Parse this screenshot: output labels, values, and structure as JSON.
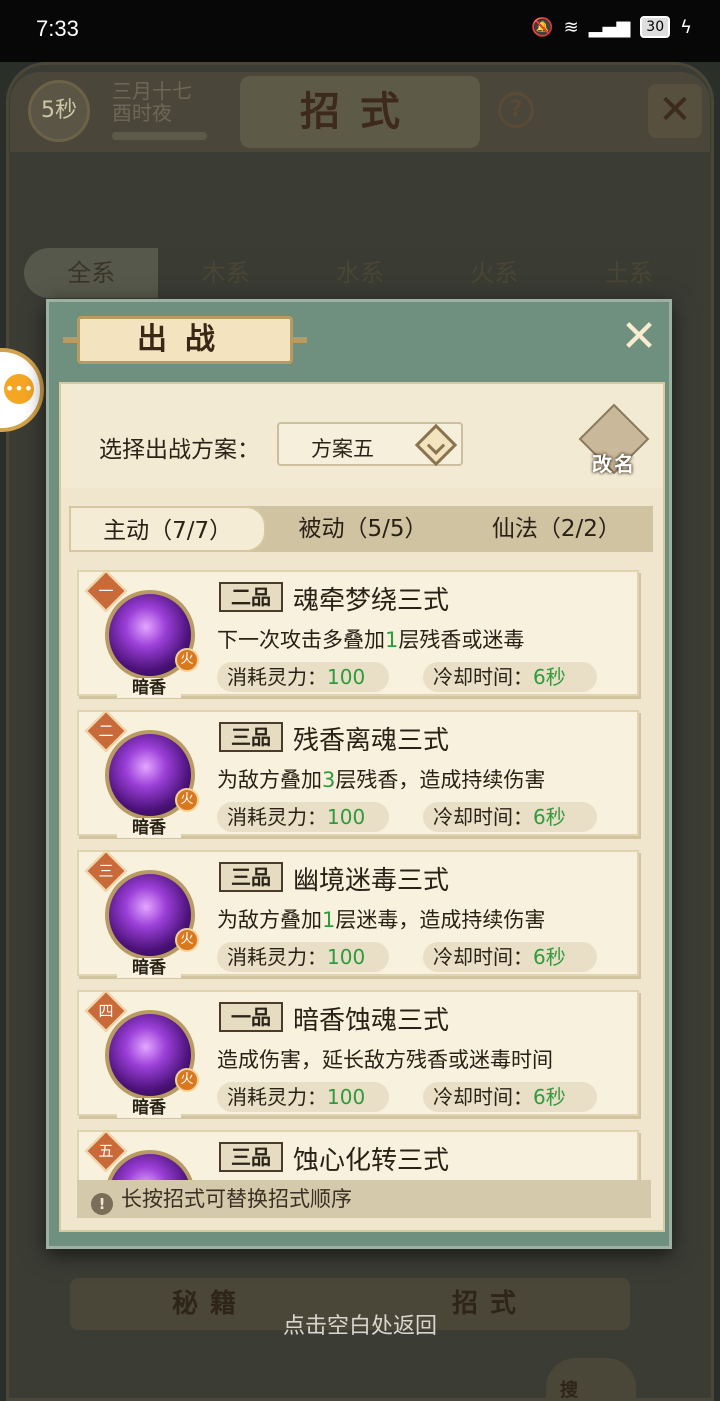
{
  "status_bar": {
    "time": "7:33",
    "battery": "30"
  },
  "background": {
    "timer": "5秒",
    "date_line1": "三月十七",
    "date_line2": "酉时夜",
    "title": "招式",
    "help": "?",
    "close": "✕",
    "element_tabs": [
      "全系",
      "木系",
      "水系",
      "火系",
      "土系"
    ],
    "bottom_tabs": [
      "秘籍",
      "招式"
    ],
    "return_hint": "点击空白处返回",
    "search": "搜"
  },
  "dialog": {
    "title": "出战",
    "close": "✕",
    "plan_label": "选择出战方案：",
    "plan_value": "方案五",
    "rename_label": "改名",
    "type_tabs": [
      "主动（7/7）",
      "被动（5/5）",
      "仙法（2/2）"
    ],
    "skills": [
      {
        "ordinal": "一",
        "grade": "二品",
        "name": "魂牵梦绕三式",
        "desc_pre": "下一次攻击多叠加",
        "desc_num": "1",
        "desc_post": "层残香或迷毒",
        "cost_label": "消耗灵力：",
        "cost": "100",
        "cd_label": "冷却时间：",
        "cd": "6秒",
        "icon_tag": "暗香",
        "element": "火"
      },
      {
        "ordinal": "二",
        "grade": "三品",
        "name": "残香离魂三式",
        "desc_pre": "为敌方叠加",
        "desc_num": "3",
        "desc_post": "层残香，造成持续伤害",
        "cost_label": "消耗灵力：",
        "cost": "100",
        "cd_label": "冷却时间：",
        "cd": "6秒",
        "icon_tag": "暗香",
        "element": "火"
      },
      {
        "ordinal": "三",
        "grade": "三品",
        "name": "幽境迷毒三式",
        "desc_pre": "为敌方叠加",
        "desc_num": "1",
        "desc_post": "层迷毒，造成持续伤害",
        "cost_label": "消耗灵力：",
        "cost": "100",
        "cd_label": "冷却时间：",
        "cd": "6秒",
        "icon_tag": "暗香",
        "element": "火"
      },
      {
        "ordinal": "四",
        "grade": "一品",
        "name": "暗香蚀魂三式",
        "desc_pre": "造成伤害，延长敌方残香或迷毒时间",
        "desc_num": "",
        "desc_post": "",
        "cost_label": "消耗灵力：",
        "cost": "100",
        "cd_label": "冷却时间：",
        "cd": "6秒",
        "icon_tag": "暗香",
        "element": "火"
      },
      {
        "ordinal": "五",
        "grade": "三品",
        "name": "蚀心化转三式",
        "desc_pre": "",
        "desc_num": "",
        "desc_post": "",
        "cost_label": "",
        "cost": "",
        "cd_label": "",
        "cd": "",
        "icon_tag": "",
        "element": ""
      }
    ],
    "hint": "长按招式可替换招式顺序"
  }
}
